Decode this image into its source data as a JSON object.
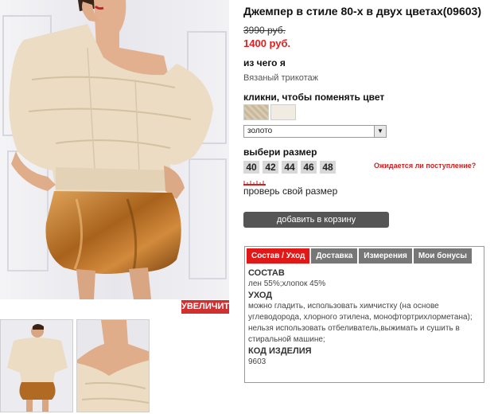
{
  "product": {
    "title": "Джемпер в стиле 80-х в двух цветах(09603)",
    "old_price": "3990 руб.",
    "new_price": "1400 руб.",
    "zoom_label": "УВЕЛИЧИТЬ"
  },
  "material": {
    "label": "из чего я",
    "value": "Вязаный трикотаж"
  },
  "color": {
    "label": "кликни, чтобы поменять цвет",
    "selected": "золото",
    "swatches": [
      "#c9b89a",
      "#f1ece1"
    ]
  },
  "size": {
    "label": "выбери размер",
    "options": [
      "40",
      "42",
      "44",
      "46",
      "48"
    ],
    "arrival_link": "Ожидается ли поступление?",
    "check_link": "проверь свой размер"
  },
  "cart": {
    "button_label": "добавить в корзину"
  },
  "tabs": {
    "items": [
      "Состав / Уход",
      "Доставка",
      "Измерения",
      "Мои бонусы"
    ],
    "content": {
      "composition_heading": "СОСТАВ",
      "composition_text": "лен 55%;хлопок 45%",
      "care_heading": "УХОД",
      "care_text": "можно гладить, использовать химчистку (на основе углеводорода, хлорного этилена, монофтортрихлорметана); нельзя использовать отбеливатель,выжимать и сушить в стиральной машине;",
      "code_heading": "КОД ИЗДЕЛИЯ",
      "code_value": "9603"
    }
  },
  "colors": {
    "accent_red": "#e01818",
    "price_red": "#e02020",
    "button_dark": "#555555",
    "tab_gray": "#777777"
  }
}
